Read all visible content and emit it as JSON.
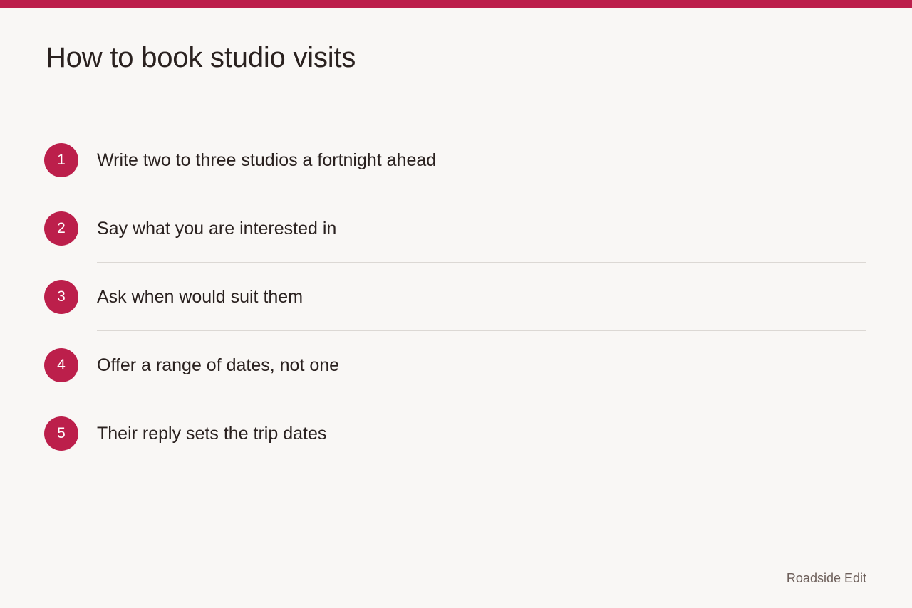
{
  "accent_color": "#bc1f4b",
  "title": "How to book studio visits",
  "steps": [
    {
      "number": "1",
      "text": "Write two to three studios a fortnight ahead"
    },
    {
      "number": "2",
      "text": "Say what you are interested in"
    },
    {
      "number": "3",
      "text": "Ask when would suit them"
    },
    {
      "number": "4",
      "text": "Offer a range of dates, not one"
    },
    {
      "number": "5",
      "text": "Their reply sets the trip dates"
    }
  ],
  "footer": {
    "brand": "Roadside Edit"
  }
}
